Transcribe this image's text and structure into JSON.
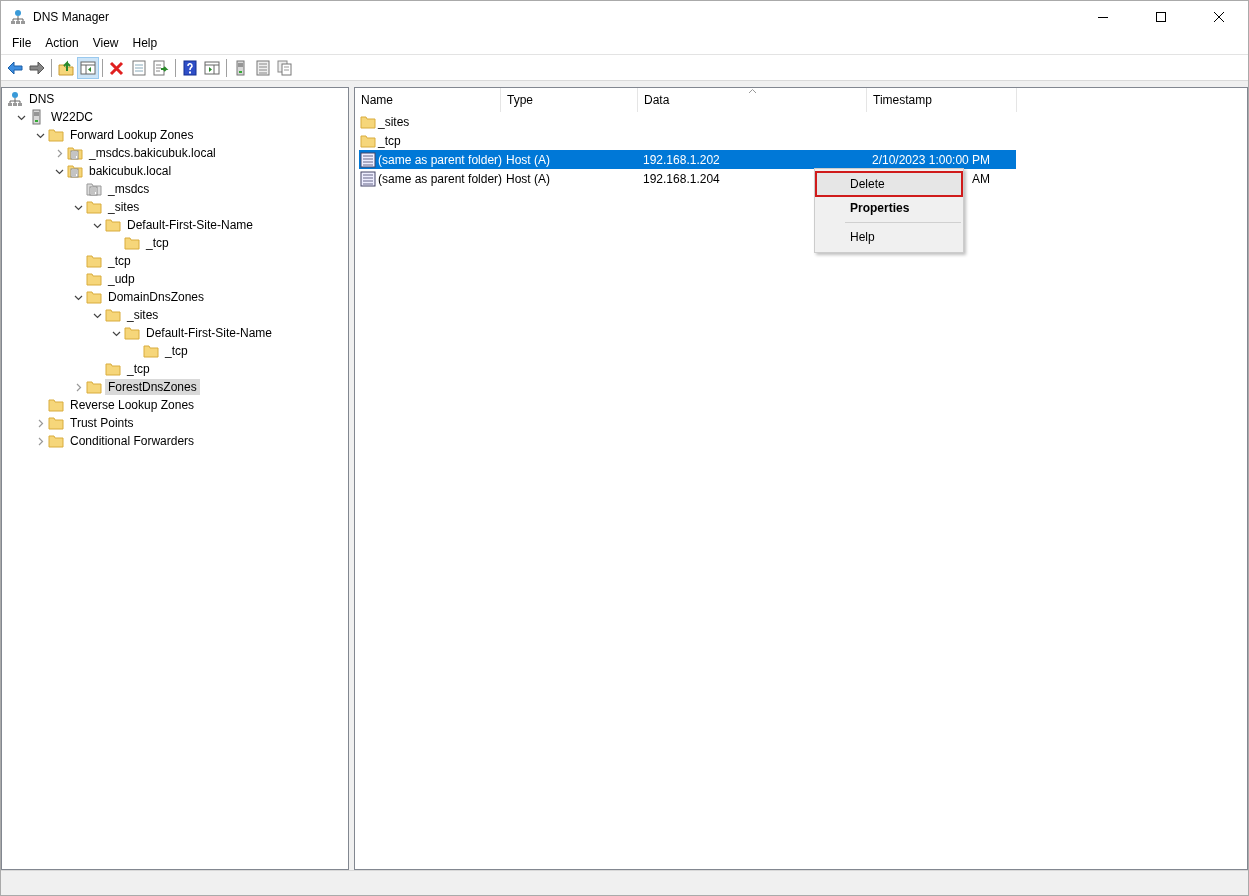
{
  "window": {
    "title": "DNS Manager"
  },
  "menu_bar": [
    "File",
    "Action",
    "View",
    "Help"
  ],
  "toolbar": [
    {
      "kind": "back",
      "pressed": false
    },
    {
      "kind": "forward",
      "pressed": false
    },
    {
      "kind": "sep"
    },
    {
      "kind": "up",
      "pressed": false
    },
    {
      "kind": "tree",
      "pressed": true
    },
    {
      "kind": "sep"
    },
    {
      "kind": "delete",
      "pressed": false
    },
    {
      "kind": "props",
      "pressed": false
    },
    {
      "kind": "export",
      "pressed": false
    },
    {
      "kind": "sep"
    },
    {
      "kind": "help",
      "pressed": false
    },
    {
      "kind": "pane",
      "pressed": false
    },
    {
      "kind": "sep"
    },
    {
      "kind": "server",
      "pressed": false
    },
    {
      "kind": "list",
      "pressed": false
    },
    {
      "kind": "copy",
      "pressed": false
    }
  ],
  "tree": [
    {
      "label": "DNS",
      "kind": "dns",
      "selected": false,
      "children": [
        {
          "label": "W22DC",
          "kind": "server",
          "expanded": true,
          "selected": false,
          "children": [
            {
              "label": "Forward Lookup Zones",
              "kind": "folder",
              "expanded": true,
              "selected": false,
              "children": [
                {
                  "label": "_msdcs.bakicubuk.local",
                  "kind": "zone",
                  "expanded": false,
                  "selected": false
                },
                {
                  "label": "bakicubuk.local",
                  "kind": "zone",
                  "expanded": true,
                  "selected": false,
                  "children": [
                    {
                      "label": "_msdcs",
                      "kind": "delegation",
                      "selected": false
                    },
                    {
                      "label": "_sites",
                      "kind": "folder",
                      "expanded": true,
                      "selected": false,
                      "children": [
                        {
                          "label": "Default-First-Site-Name",
                          "kind": "folder",
                          "expanded": true,
                          "selected": false,
                          "children": [
                            {
                              "label": "_tcp",
                              "kind": "folder",
                              "selected": false
                            }
                          ]
                        }
                      ]
                    },
                    {
                      "label": "_tcp",
                      "kind": "folder",
                      "selected": false
                    },
                    {
                      "label": "_udp",
                      "kind": "folder",
                      "selected": false
                    },
                    {
                      "label": "DomainDnsZones",
                      "kind": "folder",
                      "expanded": true,
                      "selected": false,
                      "children": [
                        {
                          "label": "_sites",
                          "kind": "folder",
                          "expanded": true,
                          "selected": false,
                          "children": [
                            {
                              "label": "Default-First-Site-Name",
                              "kind": "folder",
                              "expanded": true,
                              "selected": false,
                              "children": [
                                {
                                  "label": "_tcp",
                                  "kind": "folder",
                                  "selected": false
                                }
                              ]
                            }
                          ]
                        },
                        {
                          "label": "_tcp",
                          "kind": "folder",
                          "selected": false
                        }
                      ]
                    },
                    {
                      "label": "ForestDnsZones",
                      "kind": "folder",
                      "expanded": false,
                      "selected": true
                    }
                  ]
                }
              ]
            },
            {
              "label": "Reverse Lookup Zones",
              "kind": "folder",
              "selected": false
            },
            {
              "label": "Trust Points",
              "kind": "folder",
              "expanded": false,
              "selected": false
            },
            {
              "label": "Conditional Forwarders",
              "kind": "folder",
              "expanded": false,
              "selected": false
            }
          ]
        }
      ]
    }
  ],
  "table": {
    "columns": [
      "Name",
      "Type",
      "Data",
      "Timestamp"
    ],
    "rows": [
      {
        "kind": "folder",
        "name": "_sites",
        "selected": false
      },
      {
        "kind": "folder",
        "name": "_tcp",
        "selected": false
      },
      {
        "kind": "record",
        "name": "(same as parent folder)",
        "type": "Host (A)",
        "data": "192.168.1.202",
        "timestamp": "2/10/2023 1:00:00 PM",
        "selected": true
      },
      {
        "kind": "record",
        "name": "(same as parent folder)",
        "type": "Host (A)",
        "data": "192.168.1.204",
        "timestamp": "AM",
        "selected": false
      }
    ]
  },
  "context_menu": [
    {
      "kind": "item",
      "label": "Delete",
      "bold": false,
      "highlighted": true
    },
    {
      "kind": "item",
      "label": "Properties",
      "bold": true,
      "highlighted": false
    },
    {
      "kind": "separator"
    },
    {
      "kind": "item",
      "label": "Help",
      "bold": false,
      "highlighted": false
    }
  ]
}
